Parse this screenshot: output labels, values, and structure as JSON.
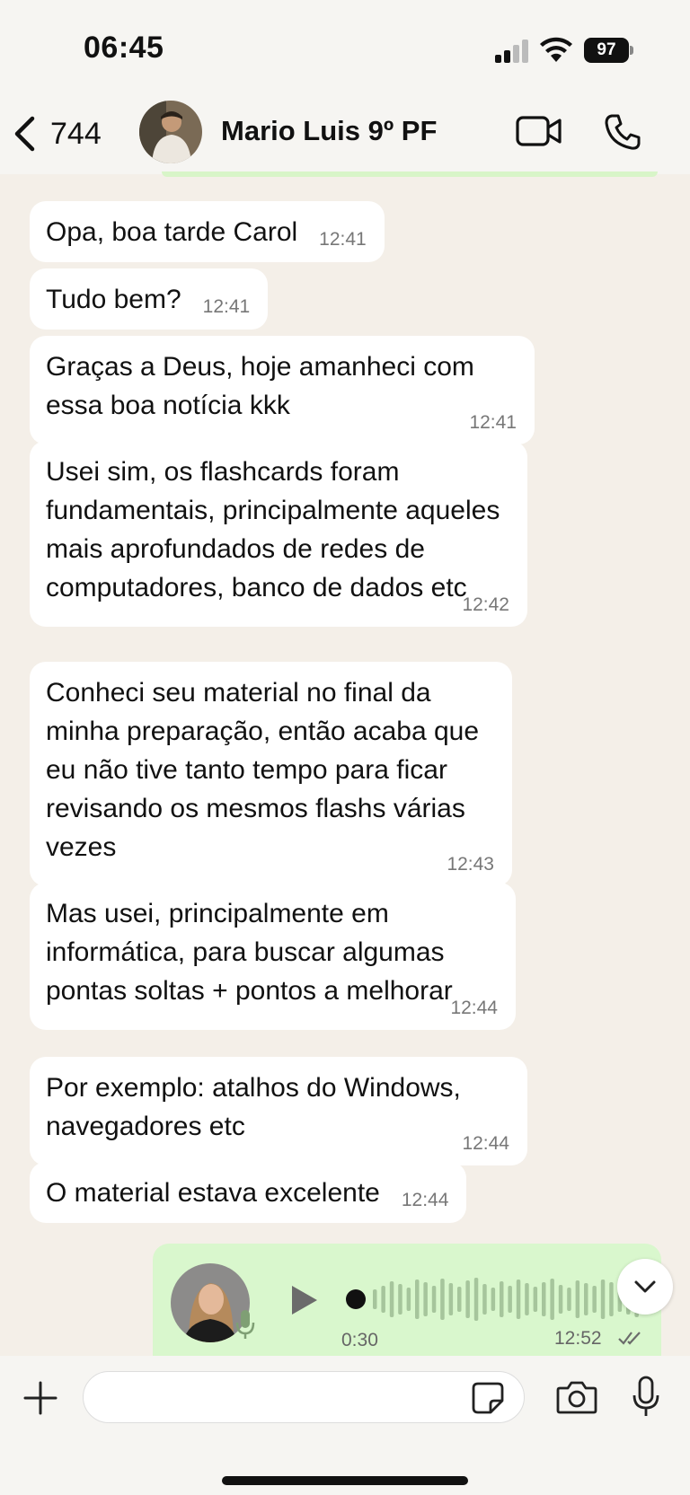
{
  "status_bar": {
    "time": "06:45",
    "battery": "97"
  },
  "header": {
    "back_count": "744",
    "contact_name": "Mario Luis 9º PF"
  },
  "messages": [
    {
      "text": "Opa, boa tarde Carol",
      "time": "12:41"
    },
    {
      "text": "Tudo bem?",
      "time": "12:41"
    },
    {
      "text": "Graças a Deus, hoje amanheci com essa boa notícia kkk",
      "time": "12:41"
    },
    {
      "text": "Usei sim, os flashcards foram fundamentais, principalmente aqueles mais aprofundados de redes de computadores, banco de dados etc",
      "time": "12:42"
    },
    {
      "text": "Conheci seu material no final da minha preparação, então acaba que eu não tive tanto tempo para ficar revisando os mesmos flashs várias vezes",
      "time": "12:43"
    },
    {
      "text": "Mas usei, principalmente em informática, para buscar algumas pontas soltas + pontos a melhorar",
      "time": "12:44"
    },
    {
      "text": "Por exemplo: atalhos do Windows, navegadores etc",
      "time": "12:44"
    },
    {
      "text": "O material estava excelente",
      "time": "12:44"
    }
  ],
  "voice_message": {
    "duration": "0:30",
    "time": "12:52",
    "status_icon": "double-check-icon"
  },
  "input": {
    "placeholder": "",
    "value": ""
  },
  "colors": {
    "incoming_bubble": "#ffffff",
    "outgoing_bubble": "#d9f7cd",
    "chat_bg": "#f4efe8"
  }
}
